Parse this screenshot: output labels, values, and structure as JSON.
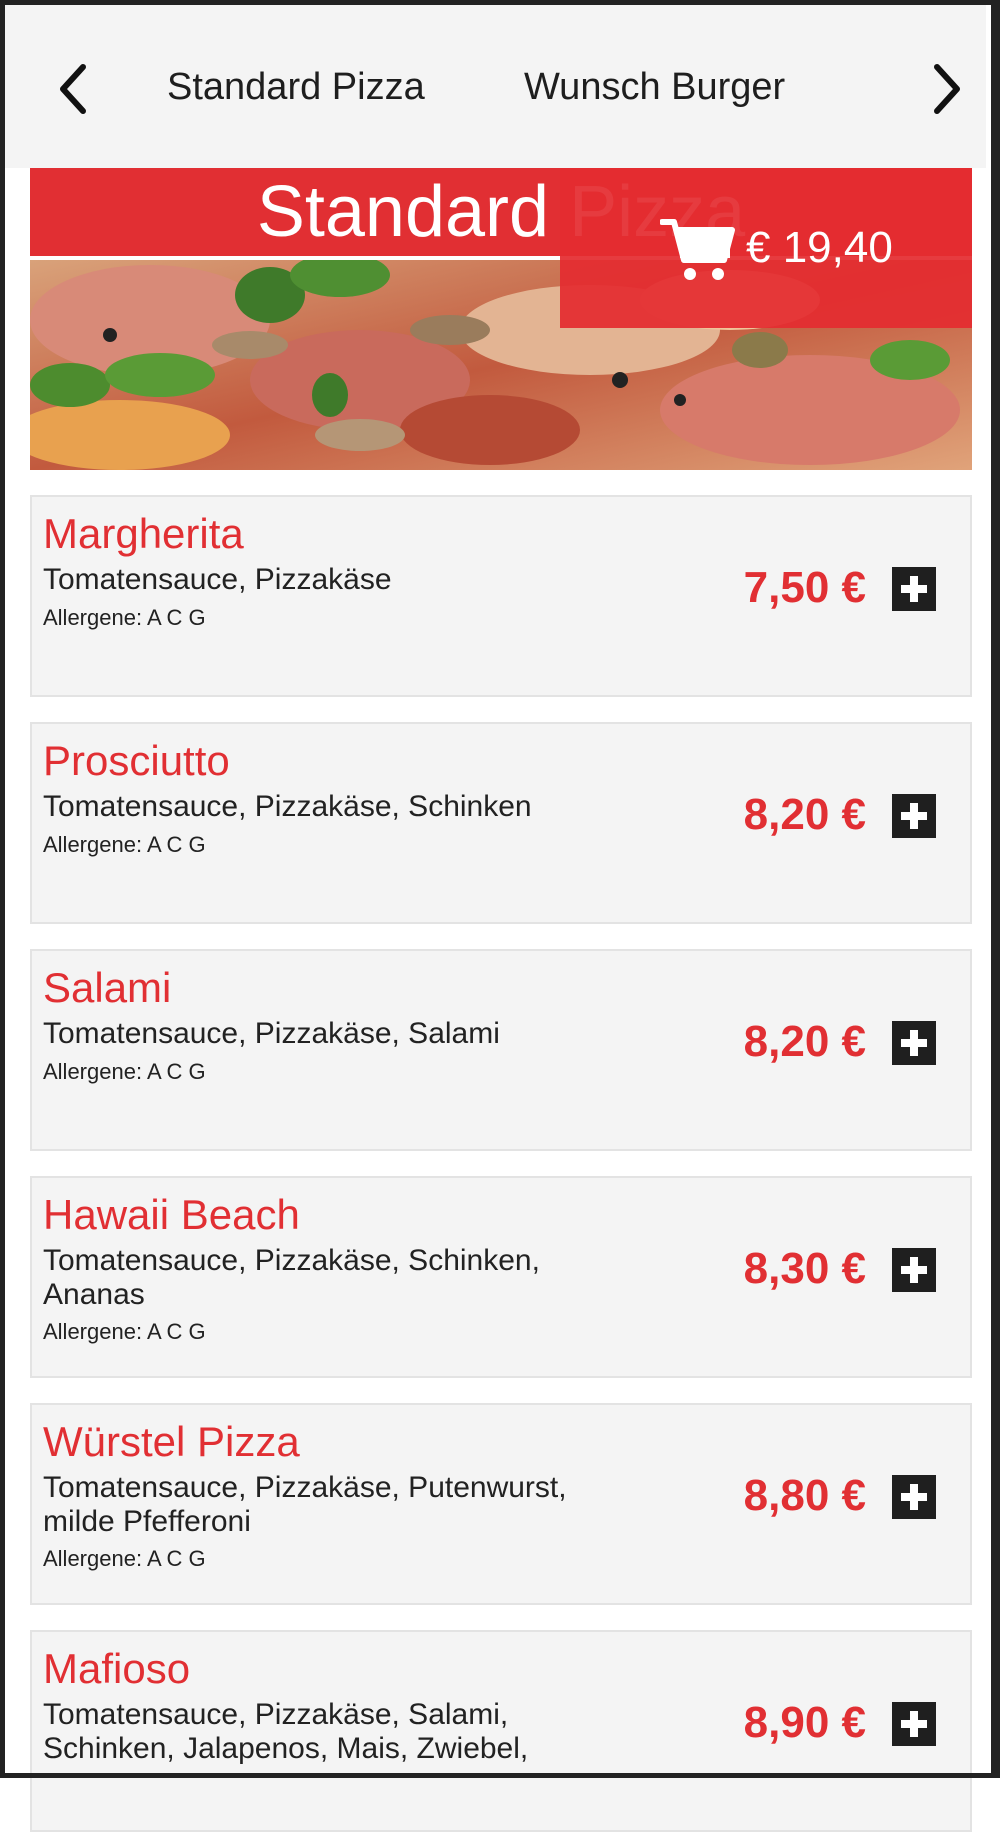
{
  "nav": {
    "tabs": [
      "Standard Pizza",
      "Wunsch Burger"
    ],
    "prev_icon": "chevron-left-icon",
    "next_icon": "chevron-right-icon"
  },
  "header": {
    "title": "Standard Pizza",
    "cart_icon": "shopping-cart-icon",
    "cart_total": "€ 19,40"
  },
  "menu": {
    "items": [
      {
        "name": "Margherita",
        "description": "Tomatensauce, Pizzakäse",
        "allergens": "Allergene: A C G",
        "price": "7,50 €"
      },
      {
        "name": "Prosciutto",
        "description": "Tomatensauce, Pizzakäse, Schinken",
        "allergens": "Allergene: A C G",
        "price": "8,20 €"
      },
      {
        "name": "Salami",
        "description": "Tomatensauce, Pizzakäse, Salami",
        "allergens": "Allergene: A C G",
        "price": "8,20 €"
      },
      {
        "name": "Hawaii Beach",
        "description": "Tomatensauce, Pizzakäse, Schinken, Ananas",
        "allergens": "Allergene: A C G",
        "price": "8,30 €"
      },
      {
        "name": "Würstel Pizza",
        "description": "Tomatensauce, Pizzakäse, Putenwurst, milde Pfefferoni",
        "allergens": "Allergene: A C G",
        "price": "8,80 €"
      },
      {
        "name": "Mafioso",
        "description": "Tomatensauce, Pizzakäse, Salami, Schinken, Jalapenos, Mais, Zwiebel,",
        "allergens": "",
        "price": "8,90 €"
      }
    ],
    "add_icon": "plus-icon"
  },
  "colors": {
    "accent": "#e12f33",
    "card_bg": "#f4f4f4",
    "text": "#222222"
  }
}
